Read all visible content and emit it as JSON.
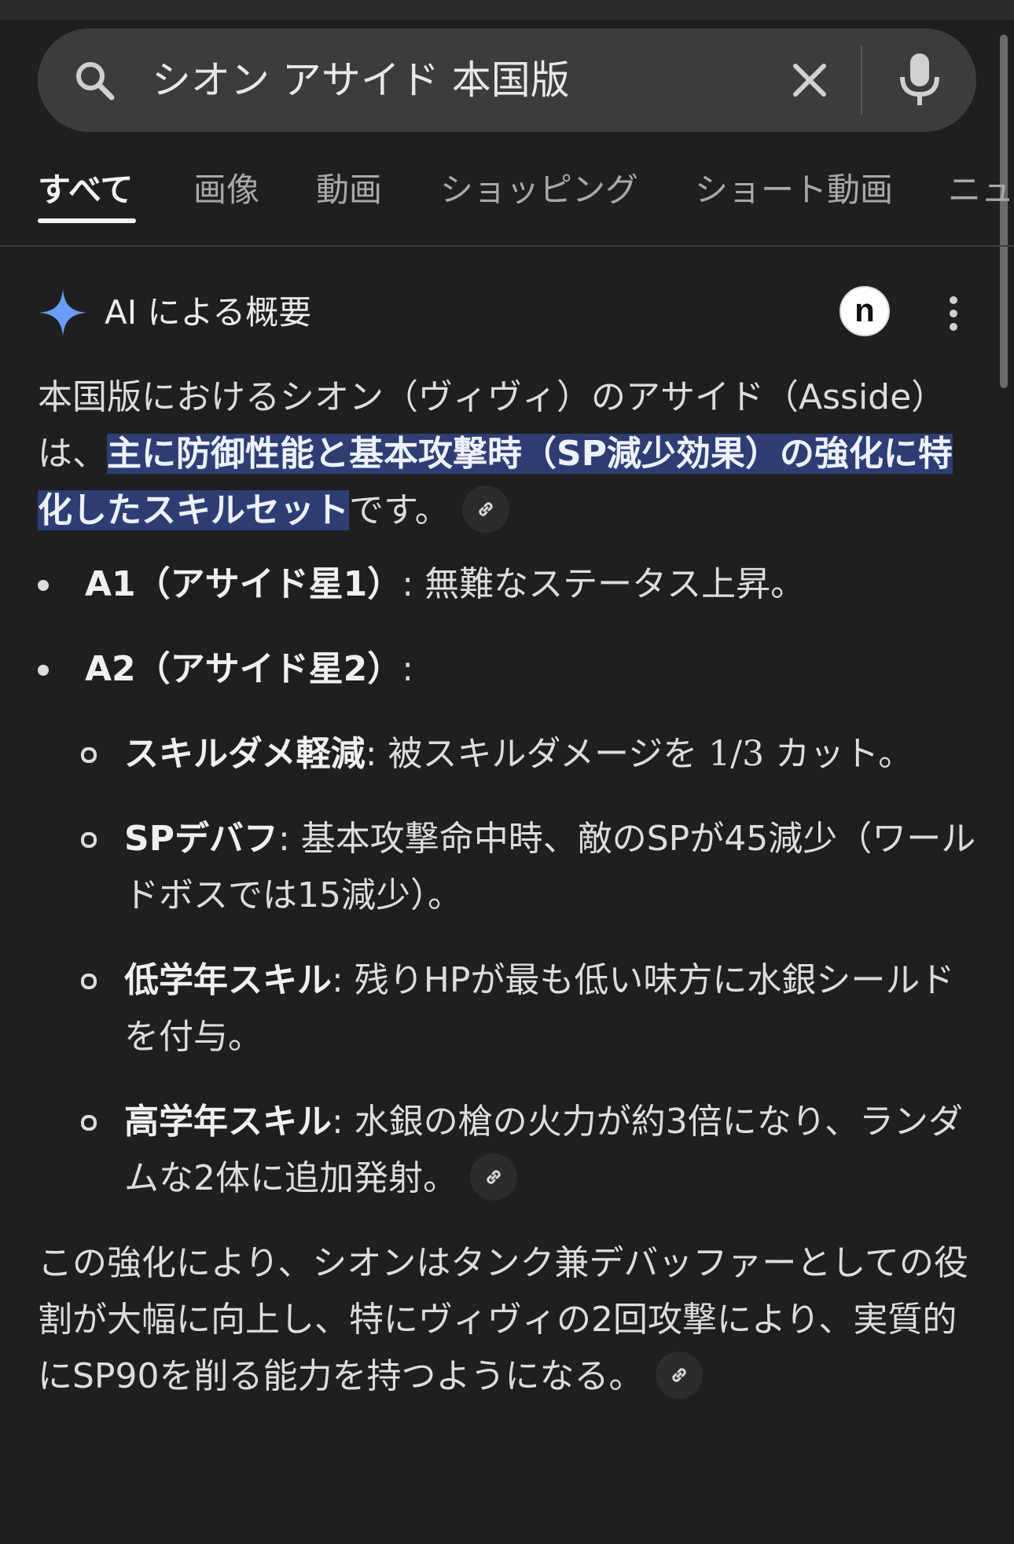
{
  "search": {
    "query": "シオン アサイド 本国版"
  },
  "tabs": [
    "すべて",
    "画像",
    "動画",
    "ショッピング",
    "ショート動画",
    "ニュ"
  ],
  "ai": {
    "title": "AI による概要",
    "avatar_letter": "n"
  },
  "summary": {
    "intro_start": "本国版におけるシオン（ヴィヴィ）のアサイド（Asside）は、",
    "intro_highlight": "主に防御性能と基本攻撃時（SP減少効果）の強化に特化したスキルセット",
    "intro_end": "です。",
    "a1_label": "A1（アサイド星1）",
    "a1_text": ": 無難なステータス上昇。",
    "a2_label": "A2（アサイド星2）",
    "a2_text": ":",
    "sub_items": [
      {
        "label": "スキルダメ軽減",
        "text_before": ": 被スキルダメージを ",
        "math": "1/3",
        "text_after": " カット。"
      },
      {
        "label": "SPデバフ",
        "text": ": 基本攻撃命中時、敵のSPが45減少（ワールドボスでは15減少）。"
      },
      {
        "label": "低学年スキル",
        "text": ": 残りHPが最も低い味方に水銀シールドを付与。"
      },
      {
        "label": "高学年スキル",
        "text": ": 水銀の槍の火力が約3倍になり、ランダムな2体に追加発射。"
      }
    ],
    "conclusion": "この強化により、シオンはタンク兼デバッファーとしての役割が大幅に向上し、特にヴィヴィの2回攻撃により、実質的にSP90を削る能力を持つようになる。"
  },
  "icons": {
    "search": "search-icon",
    "clear": "close-icon",
    "mic": "mic-icon",
    "sparkle": "sparkle-icon",
    "more": "more-vert-icon",
    "link": "link-icon"
  },
  "colors": {
    "background": "#1f1f1f",
    "search_bg": "#3c3c3d",
    "highlight": "#2e3e74",
    "sparkle": "#6d9cff"
  }
}
